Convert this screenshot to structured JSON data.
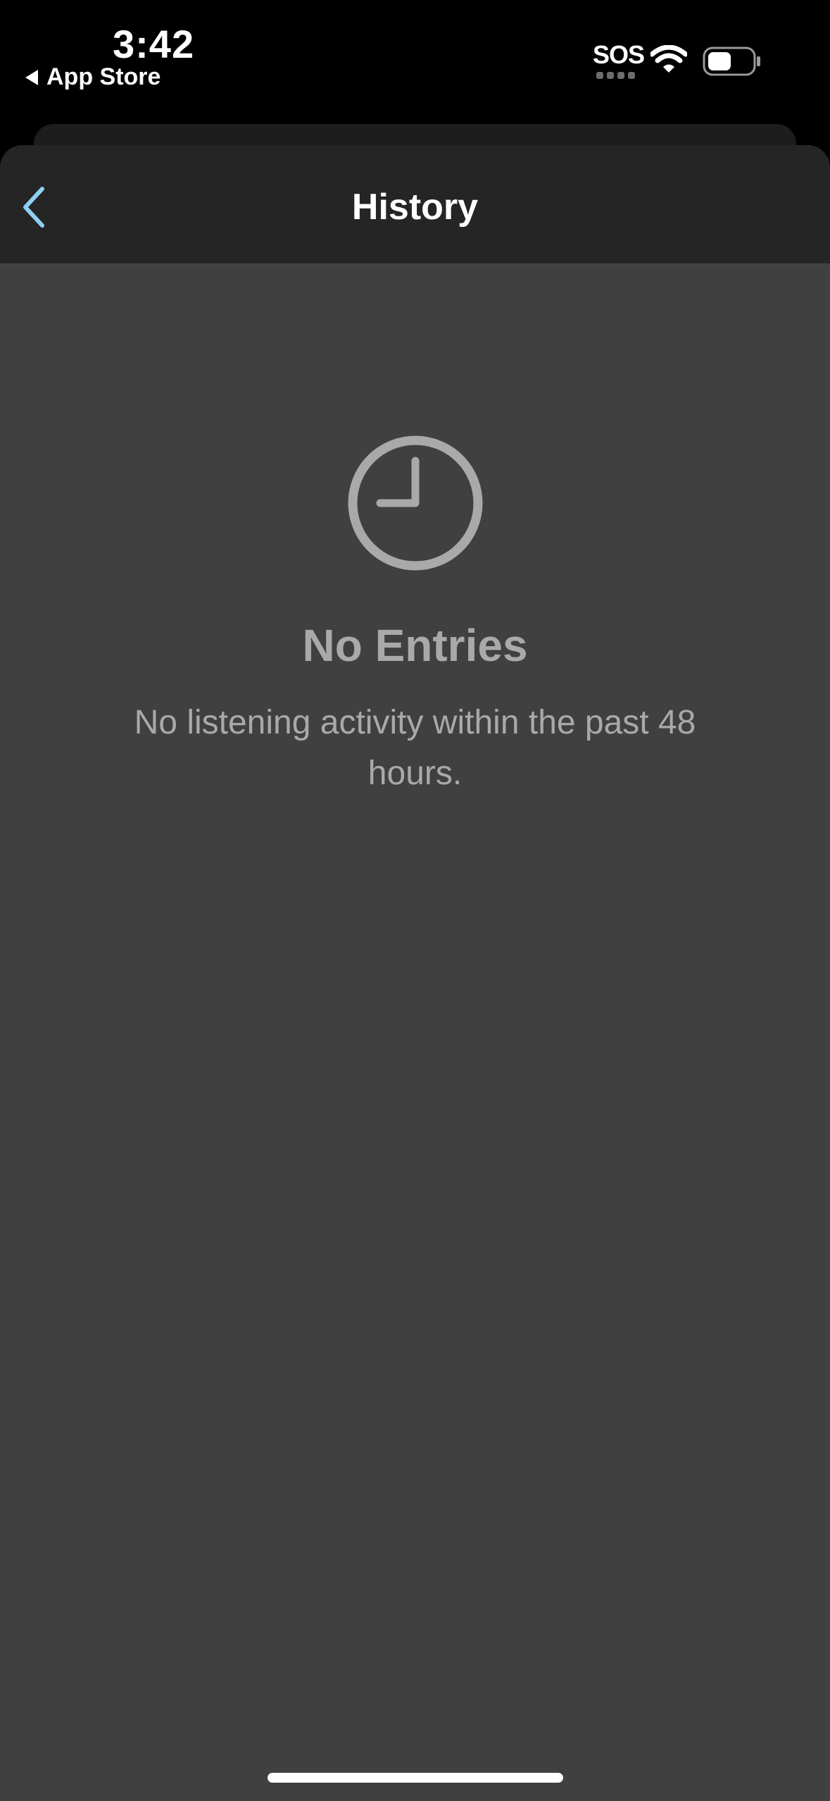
{
  "status_bar": {
    "time": "3:42",
    "back_app_label": "App Store",
    "sos_label": "SOS",
    "icons": [
      "wifi-icon",
      "battery-icon"
    ]
  },
  "nav": {
    "title": "History",
    "back_icon": "chevron-left-icon"
  },
  "empty_state": {
    "icon": "clock-icon",
    "title": "No Entries",
    "message": "No listening activity within the past 48 hours."
  },
  "colors": {
    "accent": "#8fd0f2",
    "background": "#404040",
    "nav_background": "#252525",
    "muted_text": "#a9a9ab"
  }
}
